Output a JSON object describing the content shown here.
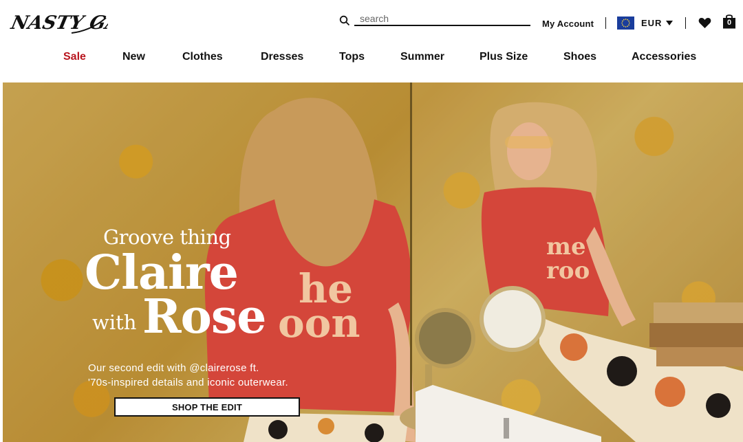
{
  "header": {
    "logo_text": "NASTY GAL",
    "search": {
      "placeholder": "search"
    },
    "account_label": "My Account",
    "currency": {
      "label": "EUR",
      "flag_icon": "eu-flag-icon"
    },
    "wishlist_icon": "heart-icon",
    "bag": {
      "icon": "shopping-bag-icon",
      "count": "0"
    }
  },
  "nav": {
    "items": [
      {
        "label": "Sale"
      },
      {
        "label": "New"
      },
      {
        "label": "Clothes"
      },
      {
        "label": "Dresses"
      },
      {
        "label": "Tops"
      },
      {
        "label": "Summer"
      },
      {
        "label": "Plus Size"
      },
      {
        "label": "Shoes"
      },
      {
        "label": "Accessories"
      }
    ]
  },
  "hero": {
    "eyebrow": "Groove thing",
    "title_line1": "Claire",
    "title_with": "with",
    "title_line2": "Rose",
    "description_line1": "Our second edit with @clairerose  ft.",
    "description_line2": "'70s-inspired details and iconic outerwear.",
    "cta_label": "SHOP THE EDIT"
  },
  "colors": {
    "sale": "#b8141d",
    "text": "#111111",
    "background": "#ffffff"
  }
}
